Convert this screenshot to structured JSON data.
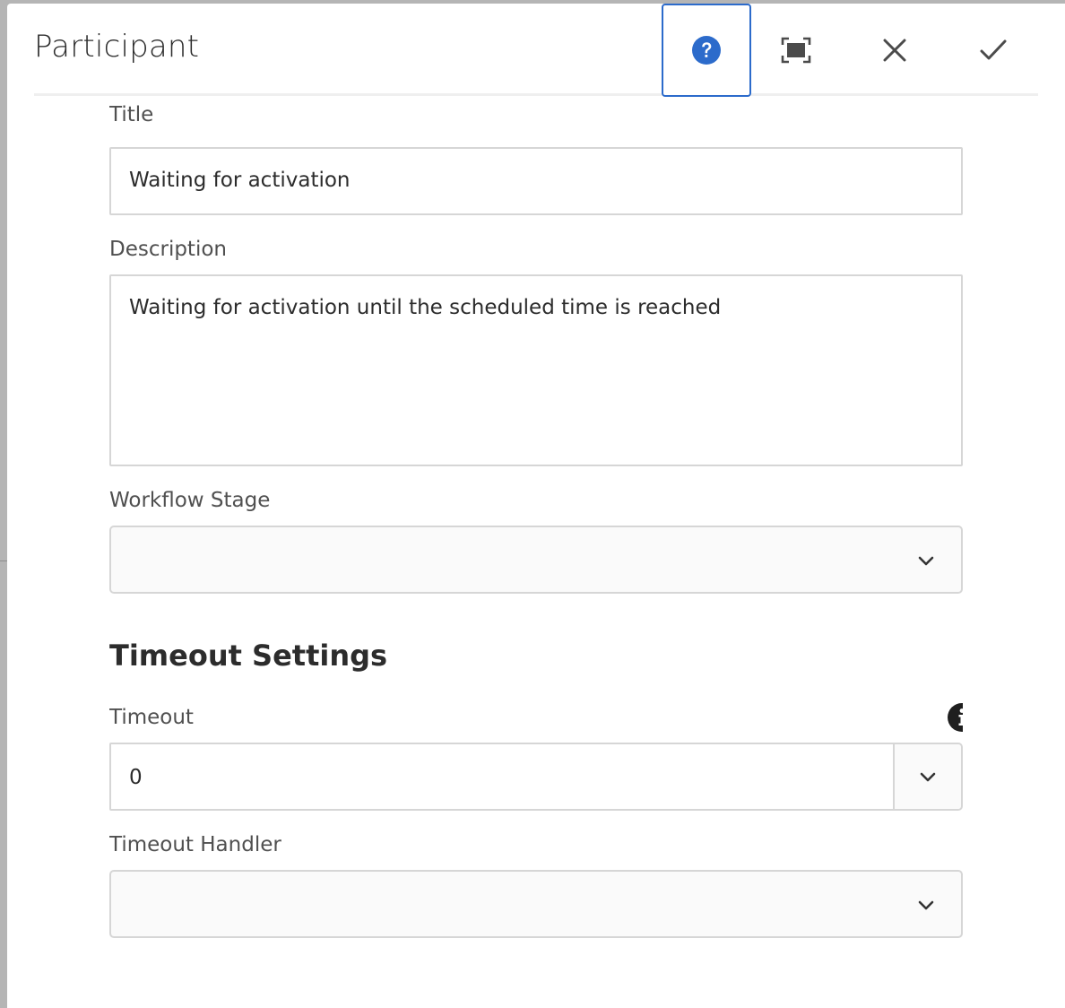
{
  "dialog": {
    "title": "Participant",
    "header_buttons": {
      "help": "help-icon",
      "fullscreen": "fullscreen-icon",
      "close": "close-icon",
      "done": "checkmark-icon"
    }
  },
  "form": {
    "title_label": "Title",
    "title_value": "Waiting for activation",
    "description_label": "Description",
    "description_value": "Waiting for activation until the scheduled time is reached",
    "workflow_stage_label": "Workflow Stage",
    "workflow_stage_value": "",
    "timeout_section_title": "Timeout Settings",
    "timeout_label": "Timeout",
    "timeout_value": "0",
    "timeout_handler_label": "Timeout Handler",
    "timeout_handler_value": ""
  },
  "colors": {
    "accent": "#2c6bcb",
    "border": "#d6d6d6",
    "text": "#2c2c2c"
  }
}
